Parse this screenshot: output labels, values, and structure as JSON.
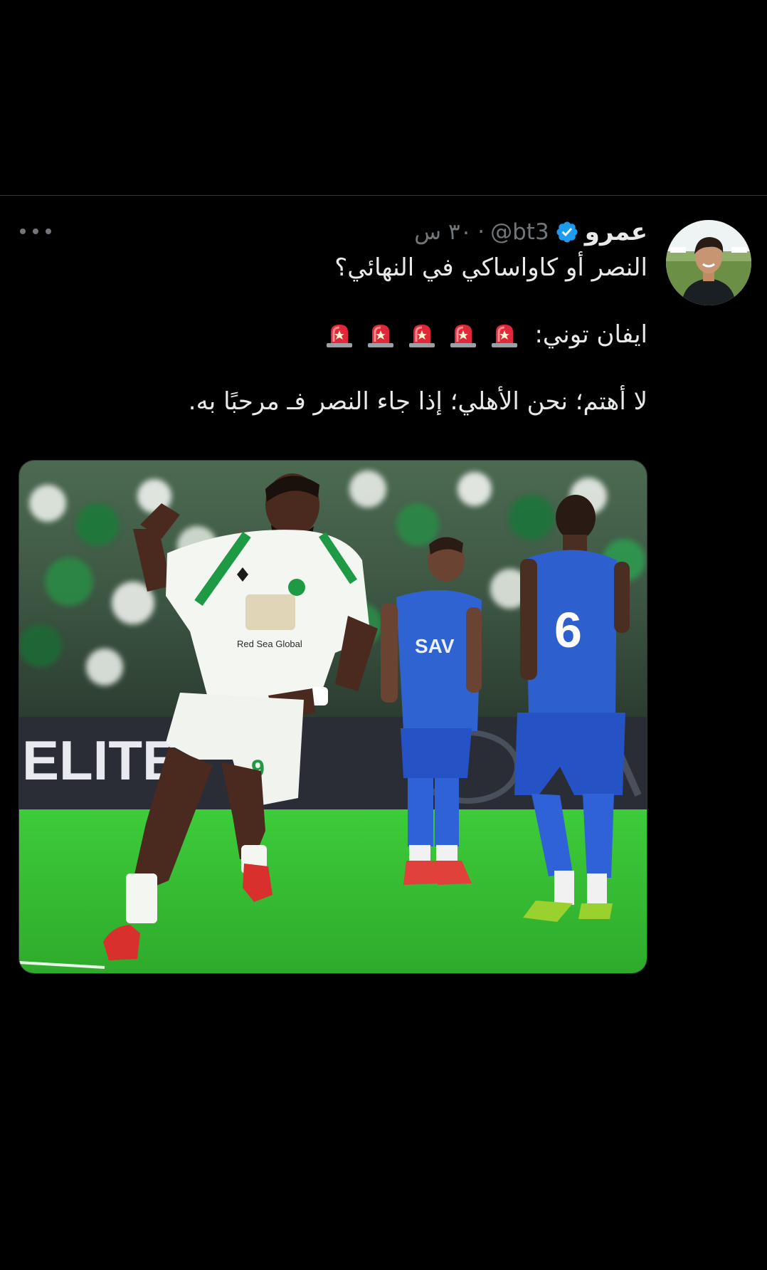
{
  "tweet": {
    "display_name": "عمرو",
    "handle": "@bt3",
    "timestamp": "٣٠ س",
    "separator": "·",
    "line1": "النصر أو كاواساكي في النهائي؟",
    "line2_label": "ايفان توني:",
    "line3": "لا أهتم؛ نحن الأهلي؛ إذا جاء النصر فـ مرحبًا به.",
    "media_banner_text": "ELITE",
    "media_sponsor_text": "Red Sea Global"
  },
  "icons": {
    "verified": "verified-badge-icon",
    "more": "more-options-icon",
    "siren": "police-siren-icon"
  },
  "colors": {
    "background": "#000000",
    "text_primary": "#e7e9ea",
    "text_secondary": "#71767b",
    "verified_blue": "#1d9bf0",
    "divider": "#2f3336"
  }
}
